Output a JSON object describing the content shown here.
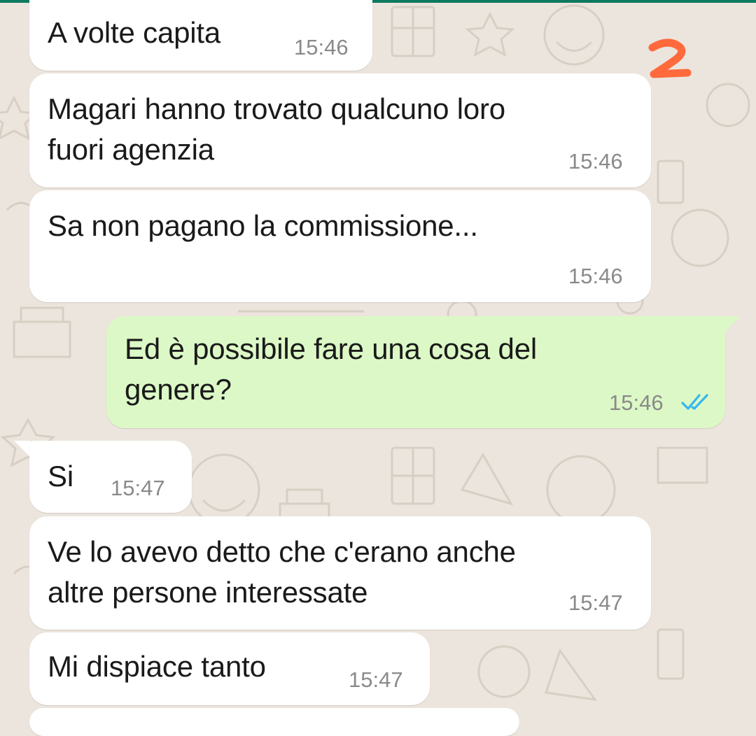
{
  "theme": {
    "incoming_bubble": "#ffffff",
    "outgoing_bubble": "#dcf8c6",
    "read_tick": "#34b7f1",
    "annotation": "#ff6a3d",
    "top_bar": "#0d7a5f"
  },
  "annotation": {
    "text": "2"
  },
  "messages": [
    {
      "direction": "incoming",
      "text": "A volte capita",
      "time": "15:46"
    },
    {
      "direction": "incoming",
      "text": "Magari hanno trovato qualcuno loro\nfuori agenzia",
      "time": "15:46"
    },
    {
      "direction": "incoming",
      "text": "Sa non pagano la commissione...",
      "time": "15:46"
    },
    {
      "direction": "outgoing",
      "text": "Ed è possibile fare una cosa del\ngenere?",
      "time": "15:46",
      "status": "read-double-check-icon"
    },
    {
      "direction": "incoming",
      "text": "Si",
      "time": "15:47"
    },
    {
      "direction": "incoming",
      "text": "Ve lo avevo detto che c'erano anche\naltre persone interessate",
      "time": "15:47"
    },
    {
      "direction": "incoming",
      "text": "Mi dispiace tanto",
      "time": "15:47"
    }
  ]
}
